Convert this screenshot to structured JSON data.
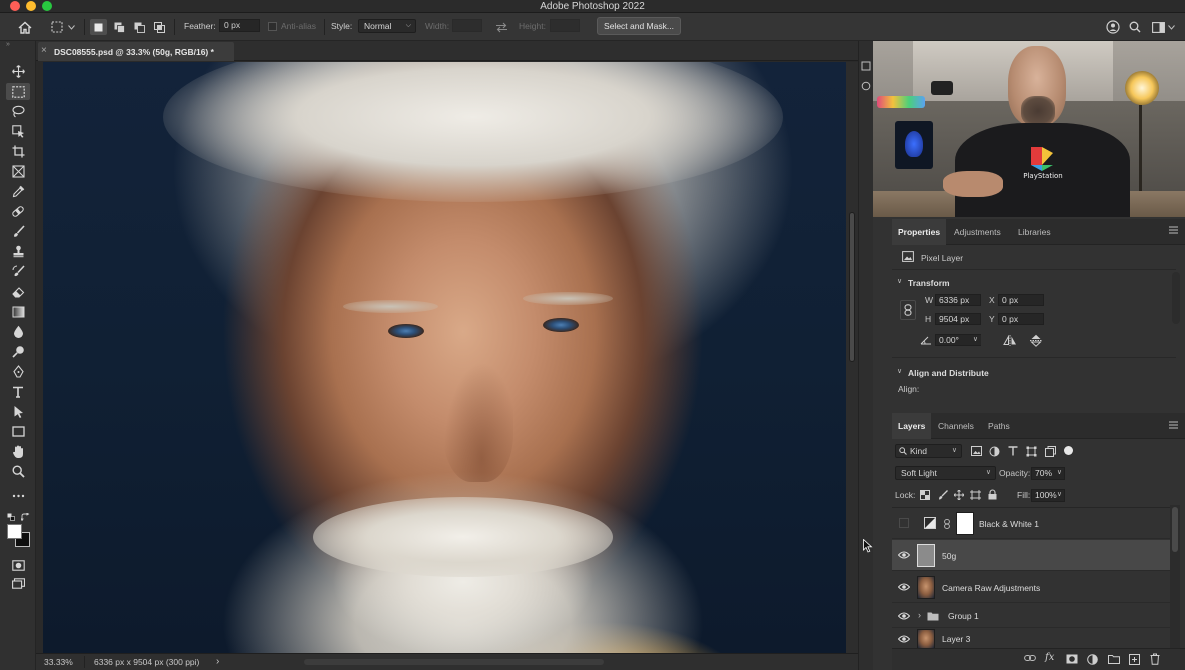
{
  "window": {
    "title": "Adobe Photoshop 2022"
  },
  "options_bar": {
    "feather_label": "Feather:",
    "feather_value": "0 px",
    "anti_alias_label": "Anti-alias",
    "style_label": "Style:",
    "style_value": "Normal",
    "width_label": "Width:",
    "height_label": "Height:",
    "select_mask_label": "Select and Mask..."
  },
  "document": {
    "tab_title": "DSC08555.psd @ 33.3% (50g, RGB/16) *",
    "tab_close": "×",
    "zoom": "33.33%",
    "dimensions": "6336 px x 9504 px (300 ppi)",
    "status_chevron": "›"
  },
  "webcam": {
    "shirt_logo_text": "PlayStation"
  },
  "properties": {
    "tabs": [
      {
        "label": "Properties",
        "active": true
      },
      {
        "label": "Adjustments",
        "active": false
      },
      {
        "label": "Libraries",
        "active": false
      }
    ],
    "layer_type": "Pixel Layer",
    "transform": {
      "title": "Transform",
      "w_label": "W",
      "w_value": "6336 px",
      "h_label": "H",
      "h_value": "9504 px",
      "x_label": "X",
      "x_value": "0 px",
      "y_label": "Y",
      "y_value": "0 px",
      "angle_value": "0.00°"
    },
    "align": {
      "title": "Align and Distribute",
      "align_label": "Align:"
    }
  },
  "layers_panel": {
    "tabs": [
      {
        "label": "Layers",
        "active": true
      },
      {
        "label": "Channels",
        "active": false
      },
      {
        "label": "Paths",
        "active": false
      }
    ],
    "filter_kind": "Kind",
    "blend_mode": "Soft Light",
    "opacity_label": "Opacity:",
    "opacity_value": "70%",
    "lock_label": "Lock:",
    "fill_label": "Fill:",
    "fill_value": "100%",
    "layers": [
      {
        "name": "Black & White 1",
        "visible": false,
        "selected": false,
        "kind": "adjustment"
      },
      {
        "name": "50g",
        "visible": true,
        "selected": true,
        "kind": "pixel"
      },
      {
        "name": "Camera Raw Adjustments",
        "visible": true,
        "selected": false,
        "kind": "pixel"
      },
      {
        "name": "Group 1",
        "visible": true,
        "selected": false,
        "kind": "group"
      },
      {
        "name": "Layer 3",
        "visible": true,
        "selected": false,
        "kind": "pixel"
      }
    ]
  },
  "colors": {
    "app_bg": "#323232",
    "panel_bg": "#2c2c2c",
    "selected_layer": "#484848",
    "canvas_background": "#13233a"
  },
  "icons": {
    "toolbar": [
      "move-icon",
      "marquee-icon",
      "lasso-icon",
      "object-select-icon",
      "crop-icon",
      "frame-icon",
      "eyedropper-icon",
      "healing-brush-icon",
      "brush-icon",
      "stamp-icon",
      "history-brush-icon",
      "eraser-icon",
      "gradient-icon",
      "blur-icon",
      "dodge-icon",
      "pen-icon",
      "type-icon",
      "path-select-icon",
      "rectangle-icon",
      "hand-icon",
      "zoom-icon",
      "more-tools-icon"
    ]
  }
}
